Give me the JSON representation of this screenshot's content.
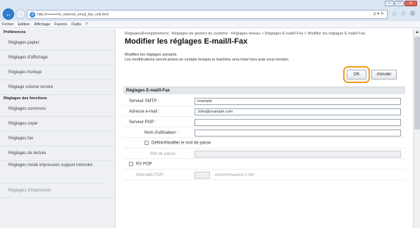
{
  "browser": {
    "url": "http://•••••••••/m_network_email_ifax_edit.html",
    "search_glyph": "ρ ▾ ↻",
    "window_controls": [
      "–",
      "□",
      "✕"
    ]
  },
  "menu": [
    "Fichier",
    "Edition",
    "Affichage",
    "Favoris",
    "Outils",
    "?"
  ],
  "sidebar": {
    "section1": "Préférences",
    "items1": [
      "Réglages papier",
      "Réglages d'affichage",
      "Réglages horloge",
      "Réglage volume sonore"
    ],
    "section2": "Réglages des fonctions",
    "items2": [
      "Réglages communs",
      "Réglages copie",
      "Réglages fax",
      "Réglages de lecture",
      "Réglages mode impression support mémoire",
      "Réglages d'impression"
    ]
  },
  "main": {
    "breadcrumb": "Réglages/Enregistrement : Réglages de gestion du système : Réglages réseau > Réglages E-mail/I-Fax > Modifier les réglages E-mail/I-Fax",
    "title": "Modifier les réglages E-mail/I-Fax",
    "desc1": "Modifiez les réglages suivants.",
    "desc2": "Les modifications seront prises en compte lorsque la machine sera mise hors puis sous tension.",
    "ok_label": "OK",
    "cancel_label": "Annuler",
    "section_title": "Réglages E-mail/I-Fax",
    "smtp_label": "Serveur SMTP :",
    "smtp_value": "example",
    "email_label": "Adresse e-mail :",
    "email_value": "John@example.com",
    "pop_label": "Serveur POP :",
    "pop_value": "",
    "user_label": "Nom d'utilisateur :",
    "user_value": "",
    "pw_check_label": "Définir/Modifier le mot de passe",
    "pw_label": "Mot de passe :",
    "rxpop_label": "RX POP",
    "interval_label": "Intervalle POP :",
    "interval_hint": "min(0=Désactivé,1-99)"
  }
}
